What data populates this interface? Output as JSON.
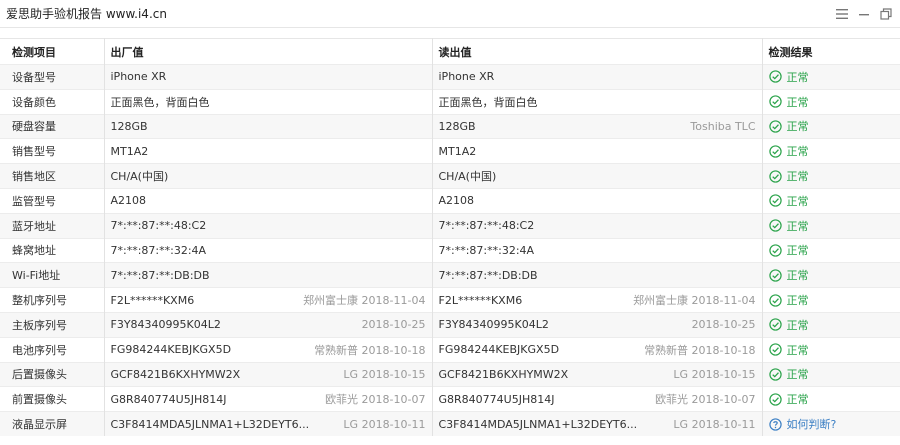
{
  "window": {
    "title": "爱思助手验机报告 www.i4.cn"
  },
  "table": {
    "headers": [
      "检测项目",
      "出厂值",
      "读出值",
      "检测结果"
    ],
    "rows": [
      {
        "item": "设备型号",
        "factory": "iPhone XR",
        "factory_note": "",
        "read": "iPhone XR",
        "read_note": "",
        "result": "正常",
        "status": "ok"
      },
      {
        "item": "设备颜色",
        "factory": "正面黑色，背面白色",
        "factory_note": "",
        "read": "正面黑色，背面白色",
        "read_note": "",
        "result": "正常",
        "status": "ok"
      },
      {
        "item": "硬盘容量",
        "factory": "128GB",
        "factory_note": "",
        "read": "128GB",
        "read_note": "Toshiba TLC",
        "result": "正常",
        "status": "ok"
      },
      {
        "item": "销售型号",
        "factory": "MT1A2",
        "factory_note": "",
        "read": "MT1A2",
        "read_note": "",
        "result": "正常",
        "status": "ok"
      },
      {
        "item": "销售地区",
        "factory": "CH/A(中国)",
        "factory_note": "",
        "read": "CH/A(中国)",
        "read_note": "",
        "result": "正常",
        "status": "ok"
      },
      {
        "item": "监管型号",
        "factory": "A2108",
        "factory_note": "",
        "read": "A2108",
        "read_note": "",
        "result": "正常",
        "status": "ok"
      },
      {
        "item": "蓝牙地址",
        "factory": "7*:**:87:**:48:C2",
        "factory_note": "",
        "read": "7*:**:87:**:48:C2",
        "read_note": "",
        "result": "正常",
        "status": "ok"
      },
      {
        "item": "蜂窝地址",
        "factory": "7*:**:87:**:32:4A",
        "factory_note": "",
        "read": "7*:**:87:**:32:4A",
        "read_note": "",
        "result": "正常",
        "status": "ok"
      },
      {
        "item": "Wi-Fi地址",
        "factory": "7*:**:87:**:DB:DB",
        "factory_note": "",
        "read": "7*:**:87:**:DB:DB",
        "read_note": "",
        "result": "正常",
        "status": "ok"
      },
      {
        "item": "整机序列号",
        "factory": "F2L******KXM6",
        "factory_note": "郑州富士康 2018-11-04",
        "read": "F2L******KXM6",
        "read_note": "郑州富士康 2018-11-04",
        "result": "正常",
        "status": "ok"
      },
      {
        "item": "主板序列号",
        "factory": "F3Y84340995K04L2",
        "factory_note": "2018-10-25",
        "read": "F3Y84340995K04L2",
        "read_note": "2018-10-25",
        "result": "正常",
        "status": "ok"
      },
      {
        "item": "电池序列号",
        "factory": "FG984244KEBJKGX5D",
        "factory_note": "常熟新普 2018-10-18",
        "read": "FG984244KEBJKGX5D",
        "read_note": "常熟新普 2018-10-18",
        "result": "正常",
        "status": "ok"
      },
      {
        "item": "后置摄像头",
        "factory": "GCF8421B6KXHYMW2X",
        "factory_note": "LG 2018-10-15",
        "read": "GCF8421B6KXHYMW2X",
        "read_note": "LG 2018-10-15",
        "result": "正常",
        "status": "ok"
      },
      {
        "item": "前置摄像头",
        "factory": "G8R840774U5JH814J",
        "factory_note": "欧菲光 2018-10-07",
        "read": "G8R840774U5JH814J",
        "read_note": "欧菲光 2018-10-07",
        "result": "正常",
        "status": "ok"
      },
      {
        "item": "液晶显示屏",
        "factory": "C3F8414MDA5JLNMA1+L32DEYT6...",
        "factory_note": "LG 2018-10-11",
        "read": "C3F8414MDA5JLNMA1+L32DEYT6...",
        "read_note": "LG 2018-10-11",
        "result": "如何判断?",
        "status": "help"
      }
    ]
  },
  "colors": {
    "ok": "#2aa34a",
    "help": "#3b7fc4"
  },
  "icons": {
    "ok": "check-circle-icon",
    "help": "question-circle-icon",
    "menu": "menu-icon",
    "minimize": "minimize-icon",
    "restore": "restore-icon"
  }
}
